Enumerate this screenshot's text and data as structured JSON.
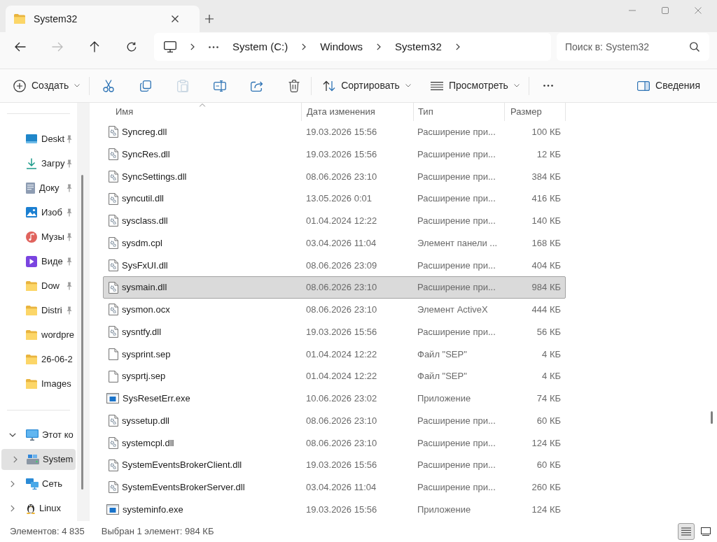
{
  "tabs": [
    {
      "title": "System32",
      "selected": true
    }
  ],
  "nav_buttons": [
    {
      "kind": "back",
      "disabled": false
    },
    {
      "kind": "forward",
      "disabled": true
    },
    {
      "kind": "up",
      "disabled": false
    },
    {
      "kind": "refresh",
      "disabled": false
    }
  ],
  "address_bar": {
    "breadcrumbs": [
      "System (C:)",
      "Windows",
      "System32"
    ]
  },
  "search": {
    "placeholder": "Поиск в: System32"
  },
  "toolbar": {
    "items": [
      {
        "kind": "new",
        "label": "Создать"
      },
      {
        "kind": "separator"
      },
      {
        "kind": "cut",
        "disabled": false
      },
      {
        "kind": "copy",
        "disabled": false
      },
      {
        "kind": "paste",
        "disabled": true
      },
      {
        "kind": "rename",
        "disabled": false
      },
      {
        "kind": "share",
        "disabled": false
      },
      {
        "kind": "delete",
        "disabled": false
      },
      {
        "kind": "separator"
      },
      {
        "kind": "sort",
        "label": "Сортировать"
      },
      {
        "kind": "view",
        "label": "Просмотреть"
      },
      {
        "kind": "separator"
      },
      {
        "kind": "more"
      }
    ],
    "details": {
      "label": "Сведения"
    }
  },
  "sidebar": {
    "quick_access": [
      {
        "kind": "desktop",
        "label": "Deskt",
        "pinned": true,
        "selected": false
      },
      {
        "kind": "downloads",
        "label": "Загру",
        "pinned": true,
        "selected": false
      },
      {
        "kind": "documents",
        "label": "Доку",
        "pinned": true,
        "selected": false
      },
      {
        "kind": "pictures",
        "label": "Изоб",
        "pinned": true,
        "selected": false
      },
      {
        "kind": "music",
        "label": "Музы",
        "pinned": true,
        "selected": false
      },
      {
        "kind": "videos",
        "label": "Виде",
        "pinned": true,
        "selected": false
      },
      {
        "kind": "folder",
        "label": "Dow",
        "pinned": true,
        "selected": false
      },
      {
        "kind": "folder",
        "label": "Distri",
        "pinned": true,
        "selected": false
      },
      {
        "kind": "folder",
        "label": "wordpre",
        "pinned": false,
        "selected": false
      },
      {
        "kind": "folder",
        "label": "26-06-2",
        "pinned": false,
        "selected": false
      },
      {
        "kind": "folder",
        "label": "Images",
        "pinned": false,
        "selected": false
      }
    ],
    "tree": [
      {
        "kind": "computer",
        "label": "Этот ко",
        "expanded": true,
        "selected": false,
        "children": [
          {
            "kind": "drive",
            "label": "System",
            "expanded": false,
            "selected": true
          }
        ]
      },
      {
        "kind": "network",
        "label": "Сеть",
        "expanded": false,
        "selected": false
      },
      {
        "kind": "linux",
        "label": "Linux",
        "expanded": false,
        "selected": false
      }
    ]
  },
  "file_list": {
    "columns": [
      {
        "label": "Имя",
        "sorted": true
      },
      {
        "label": "Дата изменения",
        "sorted": false
      },
      {
        "label": "Тип",
        "sorted": false
      },
      {
        "label": "Размер",
        "sorted": false
      }
    ],
    "rows": [
      {
        "kind": "library",
        "name": "Syncreg.dll",
        "modified": "19.03.2026 15:56",
        "type": "Расширение при...",
        "size": "100 КБ",
        "selected": false
      },
      {
        "kind": "library",
        "name": "SyncRes.dll",
        "modified": "19.03.2026 15:56",
        "type": "Расширение при...",
        "size": "12 КБ",
        "selected": false
      },
      {
        "kind": "library",
        "name": "SyncSettings.dll",
        "modified": "08.06.2026 23:10",
        "type": "Расширение при...",
        "size": "384 КБ",
        "selected": false
      },
      {
        "kind": "library",
        "name": "syncutil.dll",
        "modified": "13.05.2026 0:01",
        "type": "Расширение при...",
        "size": "416 КБ",
        "selected": false
      },
      {
        "kind": "library",
        "name": "sysclass.dll",
        "modified": "01.04.2024 12:22",
        "type": "Расширение при...",
        "size": "140 КБ",
        "selected": false
      },
      {
        "kind": "library",
        "name": "sysdm.cpl",
        "modified": "03.04.2026 11:04",
        "type": "Элемент панели ...",
        "size": "168 КБ",
        "selected": false
      },
      {
        "kind": "library",
        "name": "SysFxUI.dll",
        "modified": "08.06.2026 23:09",
        "type": "Расширение при...",
        "size": "404 КБ",
        "selected": false
      },
      {
        "kind": "library",
        "name": "sysmain.dll",
        "modified": "08.06.2026 23:10",
        "type": "Расширение при...",
        "size": "984 КБ",
        "selected": true
      },
      {
        "kind": "library",
        "name": "sysmon.ocx",
        "modified": "08.06.2026 23:10",
        "type": "Элемент ActiveX",
        "size": "444 КБ",
        "selected": false
      },
      {
        "kind": "library",
        "name": "sysntfy.dll",
        "modified": "19.03.2026 15:56",
        "type": "Расширение при...",
        "size": "56 КБ",
        "selected": false
      },
      {
        "kind": "document",
        "name": "sysprint.sep",
        "modified": "01.04.2024 12:22",
        "type": "Файл \"SEP\"",
        "size": "4 КБ",
        "selected": false
      },
      {
        "kind": "document",
        "name": "sysprtj.sep",
        "modified": "01.04.2024 12:22",
        "type": "Файл \"SEP\"",
        "size": "4 КБ",
        "selected": false
      },
      {
        "kind": "application",
        "name": "SysResetErr.exe",
        "modified": "10.06.2026 23:02",
        "type": "Приложение",
        "size": "74 КБ",
        "selected": false
      },
      {
        "kind": "library",
        "name": "syssetup.dll",
        "modified": "08.06.2026 23:10",
        "type": "Расширение при...",
        "size": "60 КБ",
        "selected": false
      },
      {
        "kind": "library",
        "name": "systemcpl.dll",
        "modified": "08.06.2026 23:10",
        "type": "Расширение при...",
        "size": "124 КБ",
        "selected": false
      },
      {
        "kind": "library",
        "name": "SystemEventsBrokerClient.dll",
        "modified": "19.03.2026 15:56",
        "type": "Расширение при...",
        "size": "60 КБ",
        "selected": false
      },
      {
        "kind": "library",
        "name": "SystemEventsBrokerServer.dll",
        "modified": "03.04.2026 11:04",
        "type": "Расширение при...",
        "size": "260 КБ",
        "selected": false
      },
      {
        "kind": "application",
        "name": "systeminfo.exe",
        "modified": "19.03.2026 15:56",
        "type": "Приложение",
        "size": "124 КБ",
        "selected": false
      }
    ]
  },
  "status_bar": {
    "item_count": "Элементов: 4 835",
    "selection": "Выбран 1 элемент: 984 КБ",
    "views": [
      {
        "kind": "details",
        "selected": true
      },
      {
        "kind": "tiles",
        "selected": false
      }
    ]
  }
}
